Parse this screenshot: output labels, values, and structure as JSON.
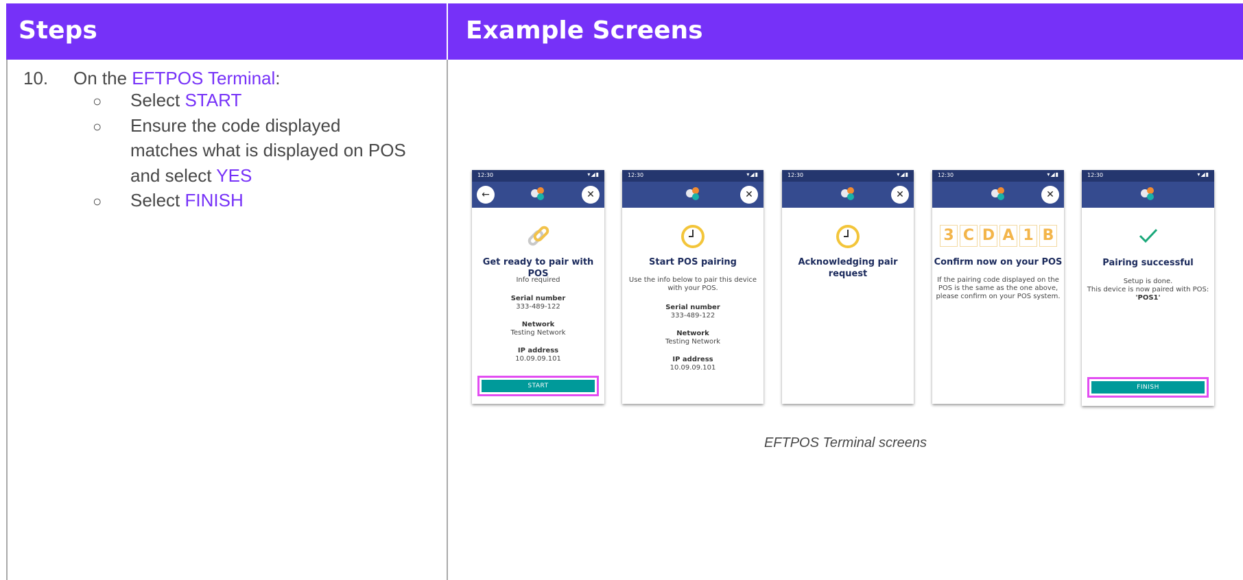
{
  "headers": {
    "steps": "Steps",
    "examples": "Example Screens"
  },
  "step": {
    "number": "10.",
    "intro_prefix": "On the ",
    "intro_highlight": "EFTPOS Terminal",
    "intro_suffix": ":",
    "b1_prefix": "Select ",
    "b1_highlight": "START",
    "b2_line1": "Ensure the code displayed",
    "b2_line2": "matches what is displayed on POS",
    "b2_line3_prefix": "and select ",
    "b2_highlight": "YES",
    "b3_prefix": "Select ",
    "b3_highlight": "FINISH",
    "bullet_symbol": "○"
  },
  "status_time": "12:30",
  "screens": {
    "s1": {
      "title": "Get ready to pair with POS",
      "subtitle": "Info required",
      "serial_label": "Serial number",
      "serial_value": "333-489-122",
      "network_label": "Network",
      "network_value": "Testing Network",
      "ip_label": "IP address",
      "ip_value": "10.09.09.101",
      "button": "START"
    },
    "s2": {
      "title": "Start POS pairing",
      "subtitle_l1": "Use the info below to pair this device",
      "subtitle_l2": "with your POS.",
      "serial_label": "Serial number",
      "serial_value": "333-489-122",
      "network_label": "Network",
      "network_value": "Testing Network",
      "ip_label": "IP address",
      "ip_value": "10.09.09.101"
    },
    "s3": {
      "title_l1": "Acknowledging pair",
      "title_l2": "request"
    },
    "s4": {
      "code": [
        "3",
        "C",
        "D",
        "A",
        "1",
        "B"
      ],
      "title": "Confirm now on your POS",
      "text_l1": "If the pairing code displayed on the",
      "text_l2": "POS is the same as the one above,",
      "text_l3": "please confirm on your POS system."
    },
    "s5": {
      "title": "Pairing successful",
      "text_l1": "Setup is done.",
      "text_l2": "This device is now paired with POS:",
      "pos_name": "'POS1'",
      "button": "FINISH"
    }
  },
  "caption": "EFTPOS Terminal screens",
  "colors": {
    "accent": "#7631f8",
    "appbar": "#354b8f",
    "button": "#009a9a",
    "highlight_border": "#e24df2",
    "code": "#f3b54a",
    "check": "#1aa87a"
  }
}
